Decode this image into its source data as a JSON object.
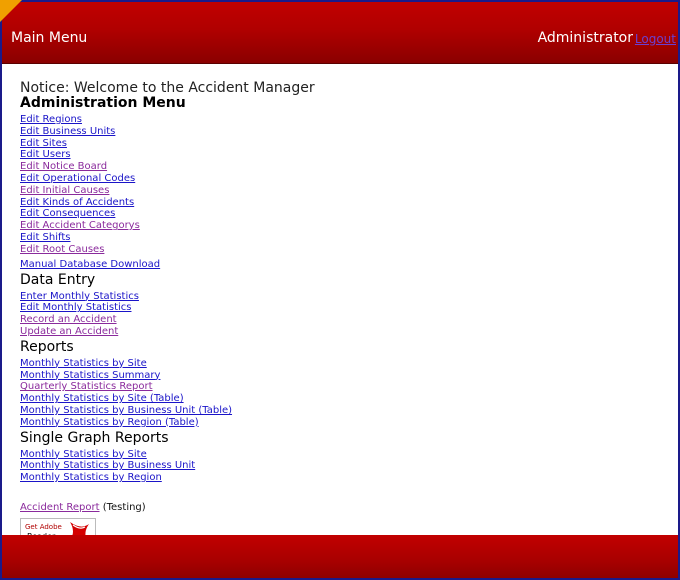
{
  "header": {
    "title": "Main Menu",
    "user": "Administrator",
    "logout_label": "Logout"
  },
  "notice": "Notice: Welcome to the Accident Manager",
  "admin": {
    "heading": "Administration Menu",
    "items": [
      {
        "label": "Edit Regions"
      },
      {
        "label": "Edit Business Units"
      },
      {
        "label": "Edit Sites"
      },
      {
        "label": "Edit Users"
      },
      {
        "label": "Edit Notice Board"
      },
      {
        "label": "Edit Operational Codes"
      },
      {
        "label": "Edit Initial Causes"
      },
      {
        "label": "Edit Kinds of Accidents"
      },
      {
        "label": "Edit Consequences"
      },
      {
        "label": "Edit Accident Categorys"
      },
      {
        "label": "Edit Shifts"
      },
      {
        "label": "Edit Root Causes"
      }
    ],
    "download_label": "Manual Database Download"
  },
  "data_entry": {
    "heading": "Data Entry",
    "items": [
      {
        "label": "Enter Monthly Statistics"
      },
      {
        "label": "Edit Monthly Statistics"
      },
      {
        "label": "Record an Accident"
      },
      {
        "label": "Update an Accident"
      }
    ]
  },
  "reports": {
    "heading": "Reports",
    "items": [
      {
        "label": "Monthly Statistics by Site"
      },
      {
        "label": "Monthly Statistics Summary"
      },
      {
        "label": "Quarterly Statistics Report"
      },
      {
        "label": "Monthly Statistics by Site (Table)"
      },
      {
        "label": "Monthly Statistics by Business Unit (Table)"
      },
      {
        "label": "Monthly Statistics by Region (Table)"
      }
    ]
  },
  "graph_reports": {
    "heading": "Single Graph Reports",
    "items": [
      {
        "label": "Monthly Statistics by Site"
      },
      {
        "label": "Monthly Statistics by Business Unit"
      },
      {
        "label": "Monthly Statistics by Region"
      }
    ]
  },
  "accident_report": {
    "link_label": "Accident Report",
    "suffix": "(Testing)"
  },
  "adobe_badge": {
    "line1": "Get Adobe",
    "line2": "Reader"
  },
  "colors": {
    "header_red": "#b00000",
    "link_blue": "#1a14c8",
    "link_visited": "#8a2a9c",
    "frame_border": "#1a1a8a"
  }
}
